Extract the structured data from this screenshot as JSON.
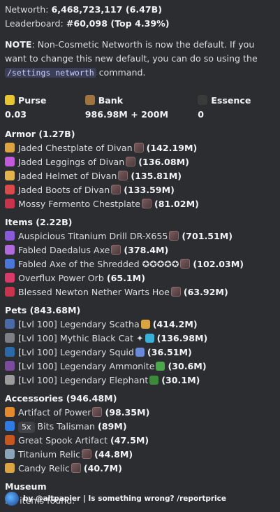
{
  "networth": {
    "label": "Networth:",
    "value": "6,468,723,117 (6.47B)"
  },
  "leaderboard": {
    "label": "Leaderboard:",
    "value": "#60,098 (Top 4.39%)"
  },
  "note": {
    "label": "NOTE",
    "text_before": ": Non-Cosmetic Networth is now the default. If you want to change this new default, you can do so using the ",
    "command": "/settings networth",
    "text_after": " command."
  },
  "stats": [
    {
      "icon": "gold-ingot-icon",
      "label": "Purse",
      "value": "0.03",
      "color": "#e8c631"
    },
    {
      "icon": "chest-icon",
      "label": "Bank",
      "value": "986.98M + 200M",
      "color": "#a0743f"
    },
    {
      "icon": "essence-skull-icon",
      "label": "Essence",
      "value": "0",
      "color": "#3a3a3a"
    }
  ],
  "sections": {
    "armor": {
      "title": "Armor (1.27B)",
      "items": [
        {
          "name": "Jaded Chestplate of Divan",
          "value": "(142.19M)",
          "color": "#d9a441"
        },
        {
          "name": "Jaded Leggings of Divan",
          "value": "(136.08M)",
          "color": "#c25bd9"
        },
        {
          "name": "Jaded Helmet of Divan",
          "value": "(135.81M)",
          "color": "#e3b44c"
        },
        {
          "name": "Jaded Boots of Divan",
          "value": "(133.59M)",
          "color": "#d94a4a"
        },
        {
          "name": "Mossy Fermento Chestplate",
          "value": "(81.02M)",
          "color": "#c8344b"
        }
      ]
    },
    "items": {
      "title": "Items (2.22B)",
      "items": [
        {
          "name": "Auspicious Titanium Drill DR-X655",
          "value": "(701.51M)",
          "color": "#8a5bd9"
        },
        {
          "name": "Fabled Daedalus Axe",
          "value": "(378.4M)",
          "color": "#b06ad9"
        },
        {
          "name": "Fabled Axe of the Shredded ✪✪✪✪✪",
          "value": "(102.03M)",
          "color": "#4a78d9"
        },
        {
          "name": "Overflux Power Orb",
          "value": "(65.1M)",
          "color": "#d93a6a"
        },
        {
          "name": "Blessed Newton Nether Warts Hoe",
          "value": "(63.92M)",
          "color": "#c8344b"
        }
      ]
    },
    "pets": {
      "title": "Pets (843.68M)",
      "items": [
        {
          "name": "[Lvl 100] Legendary Scatha",
          "value": "(414.2M)",
          "color": "#4a6aa8",
          "extra_color": "#d9a441"
        },
        {
          "name": "[Lvl 100] Mythic Black Cat",
          "value": "(136.98M)",
          "color": "#7c7f86",
          "extra_color": "#3ab0d9",
          "star": "✦"
        },
        {
          "name": "[Lvl 100] Legendary Squid",
          "value": "(36.51M)",
          "color": "#2a6aa8",
          "extra_color": "#6a8ad9"
        },
        {
          "name": "[Lvl 100] Legendary Ammonite",
          "value": "(30.6M)",
          "color": "#7d4b9e",
          "extra_color": "#4aa84a"
        },
        {
          "name": "[Lvl 100] Legendary Elephant",
          "value": "(30.1M)",
          "color": "#9b9b9b",
          "extra_color": "#3d8a3d"
        }
      ]
    },
    "accessories": {
      "title": "Accessories (946.48M)",
      "items": [
        {
          "name": "Artifact of Power",
          "value": "(98.35M)",
          "color": "#e38a2c"
        },
        {
          "badge": "5x",
          "name": "Bits Talisman",
          "value": "(89M)",
          "color": "#2f7be3"
        },
        {
          "name": "Great Spook Artifact",
          "value": "(47.5M)",
          "color": "#c8561f"
        },
        {
          "name": "Titanium Relic",
          "value": "(44.8M)",
          "color": "#8aa4b8"
        },
        {
          "name": "Candy Relic",
          "value": "(40.7M)",
          "color": "#d9a441"
        }
      ]
    },
    "museum": {
      "title": "Museum",
      "text": "No items found."
    }
  },
  "footer": {
    "text": "by @altpapier | Is something wrong? /reportprice"
  }
}
